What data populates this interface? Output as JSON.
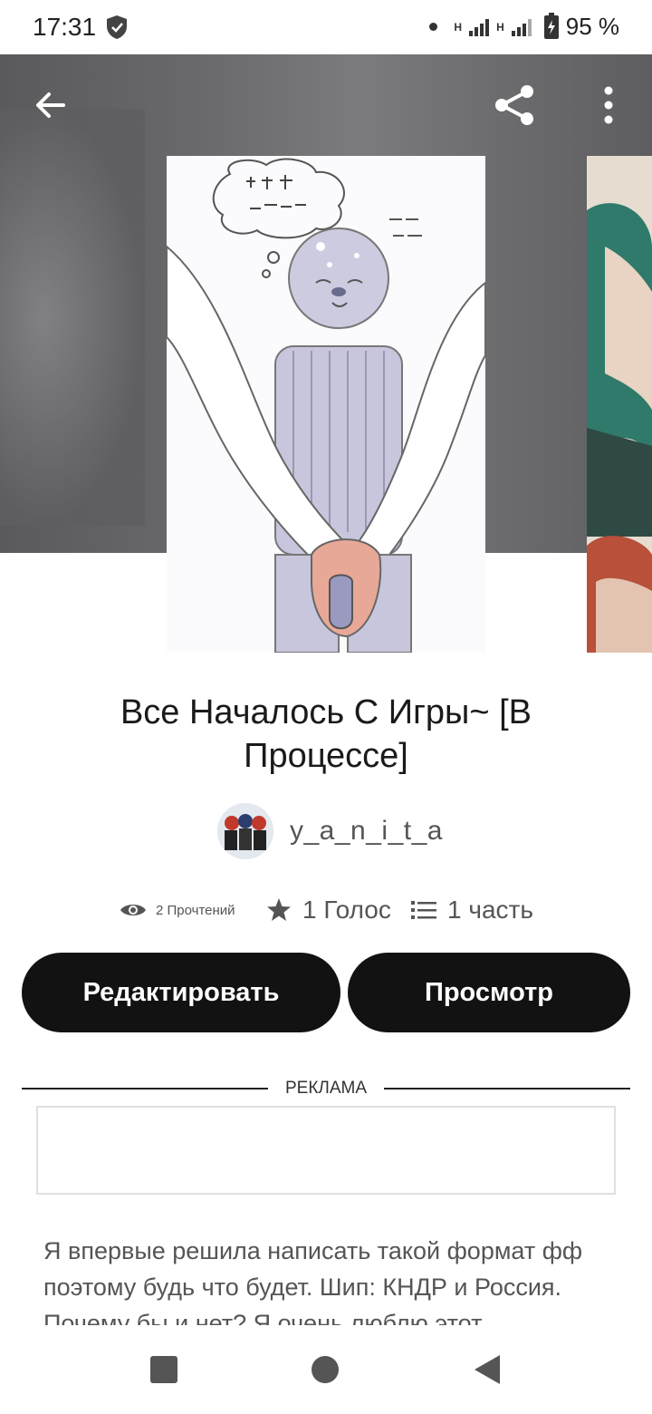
{
  "status_bar": {
    "time": "17:31",
    "network_label": "H",
    "battery": "95 %"
  },
  "header": {
    "back_icon": "arrow-left-icon",
    "share_icon": "share-icon",
    "more_icon": "more-vertical-icon"
  },
  "story": {
    "title": "Все Началось С Игры~ [В Процессе]",
    "author": "y_a_n_i_t_a",
    "stats": {
      "reads": "2 Прочтений",
      "votes": "1 Голос",
      "parts": "1 часть"
    },
    "description": "Я впервые решила написать такой формат фф поэтому будь что будет. Шип: КНДР и Россия. Почему бы и нет? Я очень люблю этот"
  },
  "actions": {
    "edit_label": "Редактировать",
    "view_label": "Просмотр"
  },
  "ad": {
    "label": "РЕКЛАМА"
  },
  "colors": {
    "button_bg": "#121212",
    "button_text": "#ffffff",
    "hero_bg": "#6a6a6c"
  }
}
